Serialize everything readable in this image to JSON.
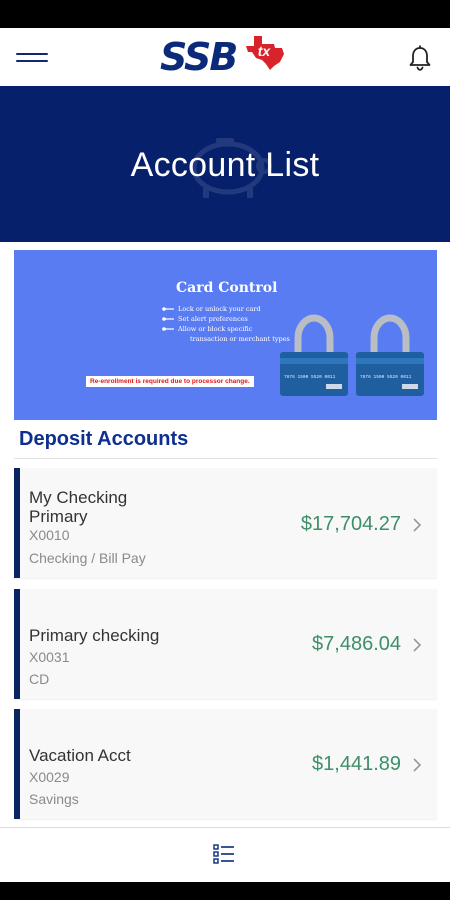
{
  "header": {
    "logo_text": "SSB",
    "logo_badge": "tx",
    "menu_icon": "hamburger-menu-icon",
    "bell_icon": "bell-icon"
  },
  "hero": {
    "title": "Account List"
  },
  "banner": {
    "title": "Card Control",
    "bullets": [
      "Lock or unlock your card",
      "Set alert preferences",
      "Allow or block specific",
      "transaction or merchant types"
    ],
    "notice": "Re-enrollment is required due to processor change.",
    "card_numbers": [
      "7876 1500 5520 0011",
      "7876 1500 5520 0011"
    ]
  },
  "section": {
    "title": "Deposit Accounts"
  },
  "accounts": [
    {
      "name": "My Checking Primary",
      "number": "X0010",
      "type": "Checking / Bill Pay",
      "balance": "$17,704.27"
    },
    {
      "name": "Primary checking",
      "number": "X0031",
      "type": "CD",
      "balance": "$7,486.04"
    },
    {
      "name": "Vacation Acct",
      "number": "X0029",
      "type": "Savings",
      "balance": "$1,441.89"
    }
  ],
  "colors": {
    "navy": "#06206b",
    "accent_blue": "#0e2f8f",
    "banner_blue": "#5a7cf2",
    "balance_green": "#3e8f68",
    "logo_red": "#d8232a"
  }
}
